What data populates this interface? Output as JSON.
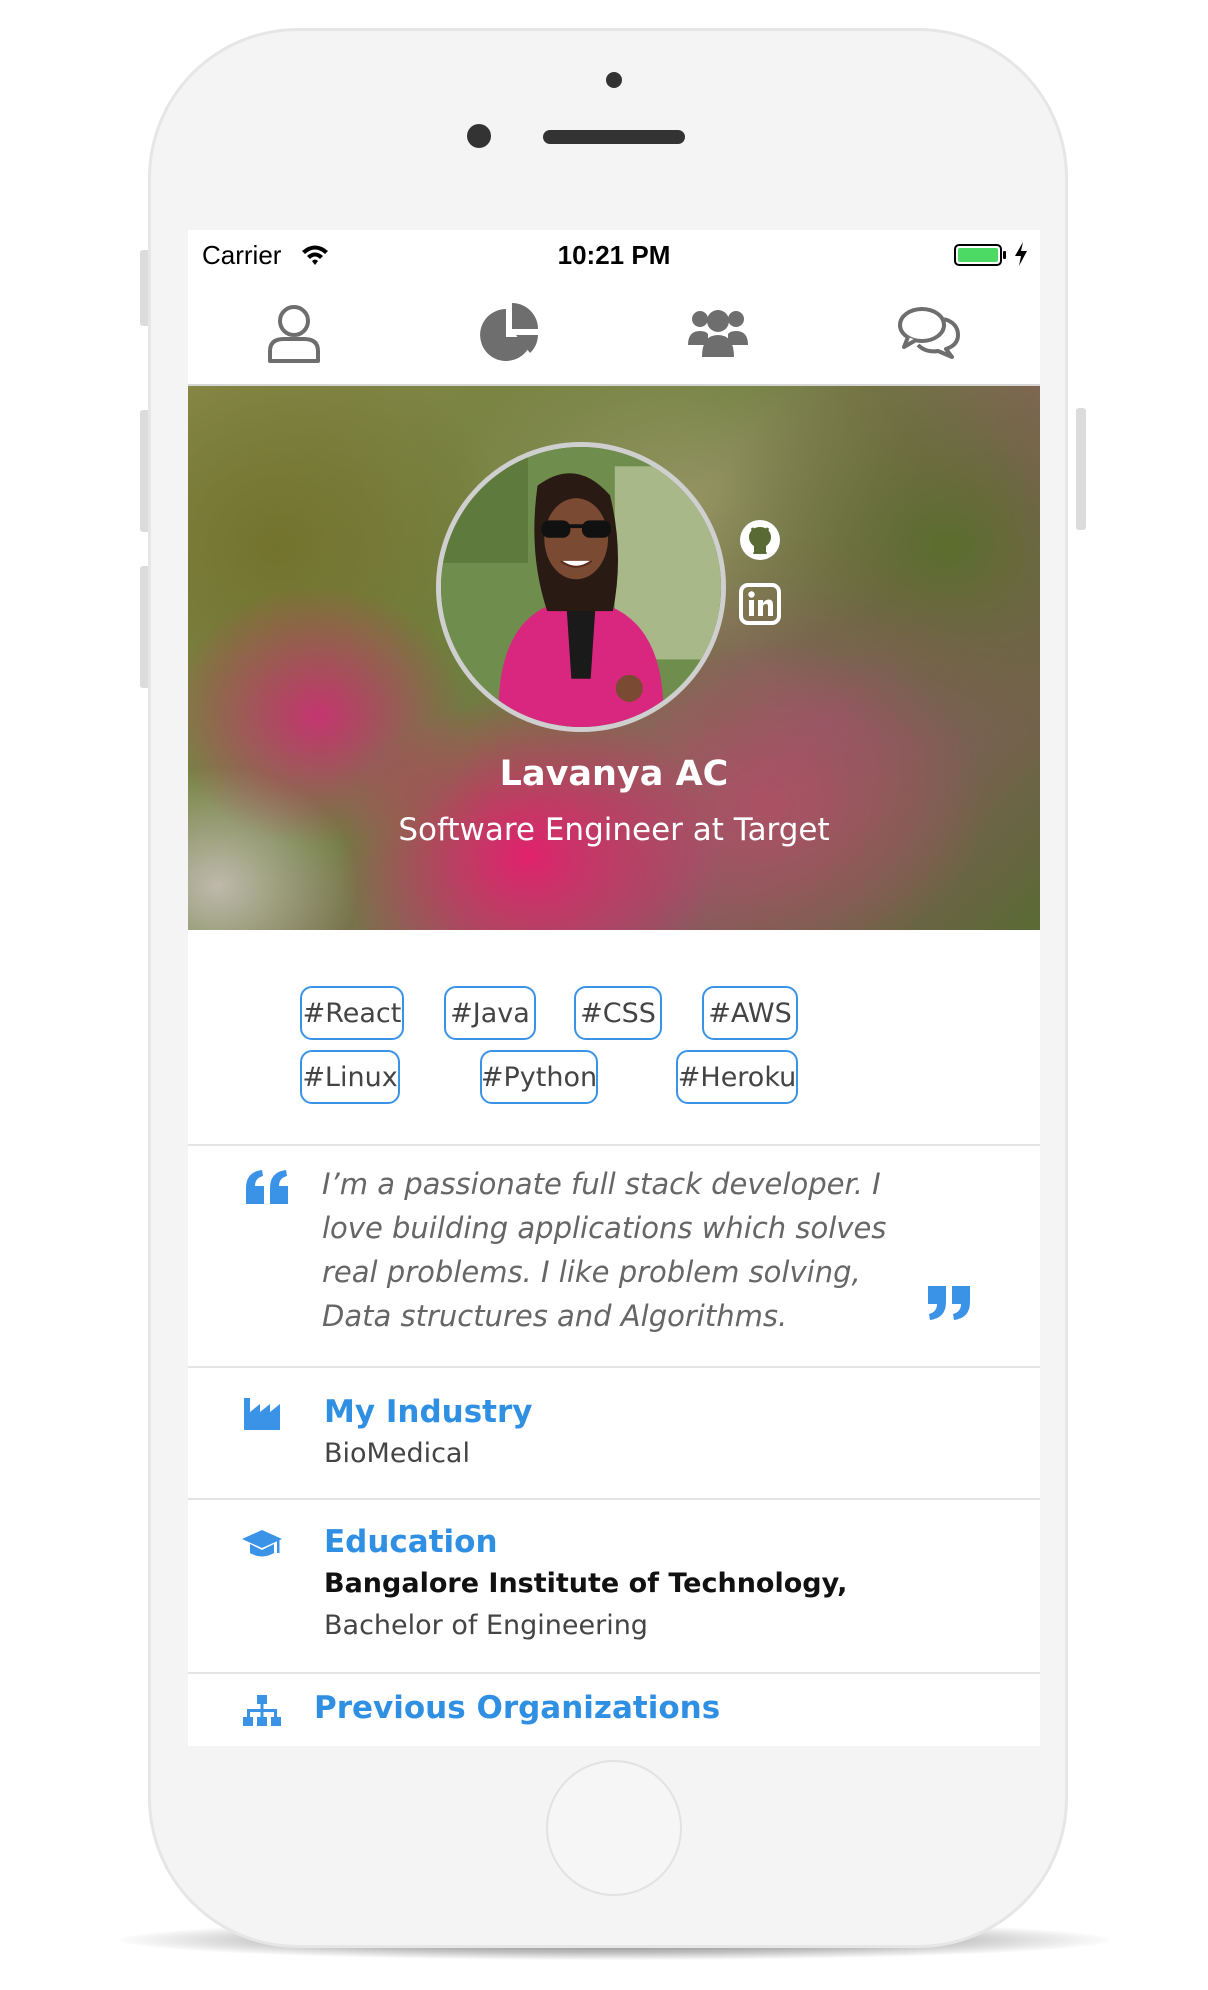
{
  "status_bar": {
    "carrier": "Carrier",
    "time": "10:21 PM"
  },
  "tabs": [
    {
      "name": "profile",
      "icon": "user-icon"
    },
    {
      "name": "stats",
      "icon": "pie-chart-icon"
    },
    {
      "name": "people",
      "icon": "group-icon"
    },
    {
      "name": "messages",
      "icon": "chat-bubbles-icon"
    }
  ],
  "profile": {
    "name": "Lavanya AC",
    "title": "Software Engineer at Target",
    "links": [
      "github-icon",
      "linkedin-icon"
    ]
  },
  "tags": [
    "#React",
    "#Java",
    "#CSS",
    "#AWS",
    "#Linux",
    "#Python",
    "#Heroku"
  ],
  "quote": {
    "lines": [
      "I’m a passionate full stack developer. I",
      "love building applications which solves",
      "real problems. I like problem solving,",
      "Data structures and Algorithms."
    ]
  },
  "industry": {
    "heading": "My Industry",
    "value": "BioMedical"
  },
  "education": {
    "heading": "Education",
    "school": "Bangalore Institute of Technology,",
    "degree": "Bachelor of Engineering"
  },
  "previous": {
    "heading": "Previous Organizations"
  },
  "colors": {
    "accent": "#3a93e6",
    "icon_gray": "#6e6e6e",
    "battery": "#4cd964"
  }
}
